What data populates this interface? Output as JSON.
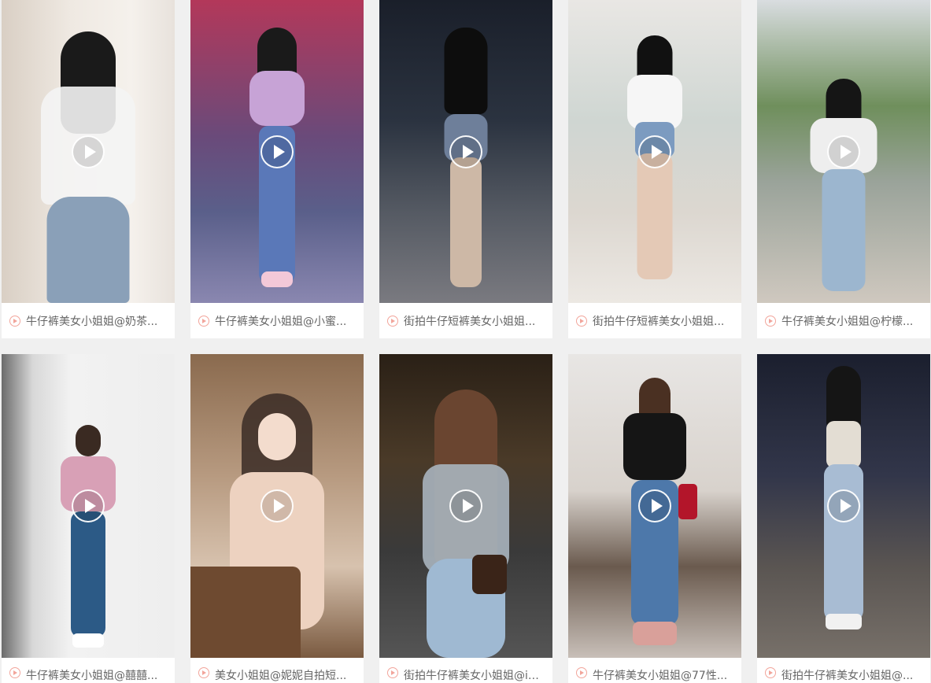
{
  "videos": [
    {
      "caption": "牛仔裤美女小姐姐@奶茶..."
    },
    {
      "caption": "牛仔裤美女小姐姐@小蜜..."
    },
    {
      "caption": "街拍牛仔短裤美女小姐姐..."
    },
    {
      "caption": "街拍牛仔短裤美女小姐姐..."
    },
    {
      "caption": "牛仔裤美女小姐姐@柠檬..."
    },
    {
      "caption": "牛仔裤美女小姐姐@囍囍..."
    },
    {
      "caption": "美女小姐姐@妮妮自拍短..."
    },
    {
      "caption": "街拍牛仔裤美女小姐姐@in..."
    },
    {
      "caption": "牛仔裤美女小姐姐@77性..."
    },
    {
      "caption": "街拍牛仔裤美女小姐姐@..."
    }
  ],
  "icons": {
    "play": "play-circle-icon",
    "caption": "small-play-circle-icon"
  },
  "colors": {
    "page_background": "#f0f0f0",
    "card_background": "#ffffff",
    "caption_text": "#666666",
    "caption_icon": "#f2a59b"
  }
}
